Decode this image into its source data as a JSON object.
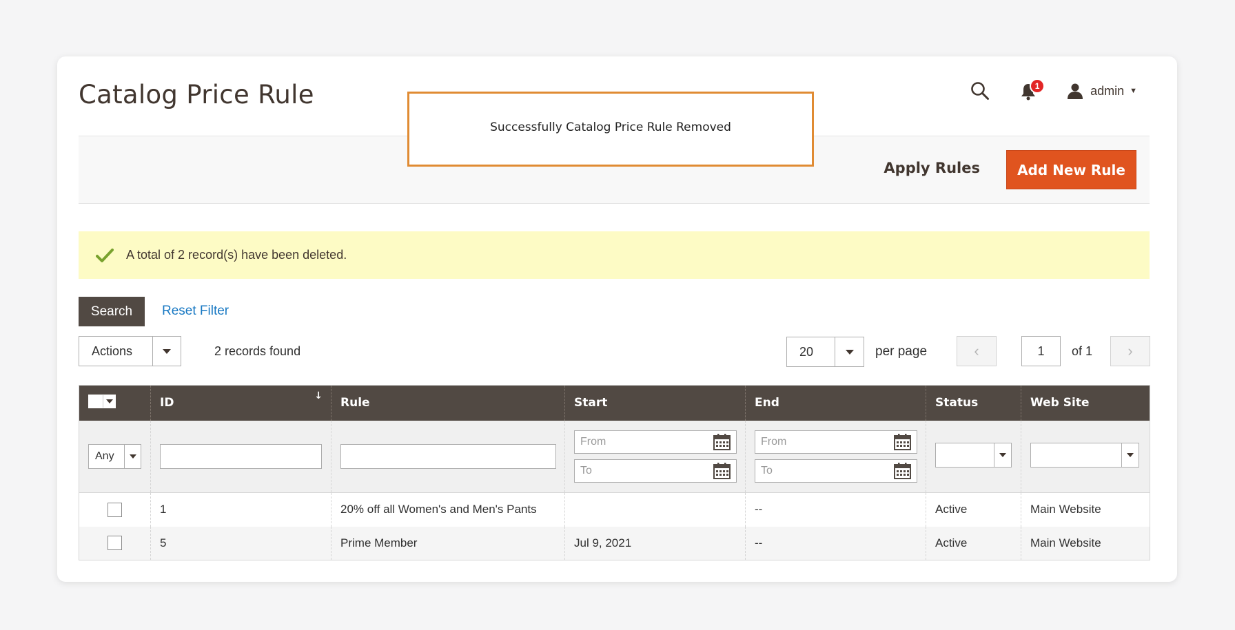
{
  "header": {
    "title": "Catalog Price Rule",
    "notification_count": "1",
    "user_name": "admin"
  },
  "callout": {
    "text": "Successfully Catalog Price Rule Removed"
  },
  "action_bar": {
    "apply_label": "Apply Rules",
    "add_label": "Add New Rule"
  },
  "message": {
    "text": "A total of 2 record(s) have been deleted."
  },
  "toolbar": {
    "search_label": "Search",
    "reset_label": "Reset Filter",
    "actions_label": "Actions",
    "records_found": "2 records found",
    "per_page_value": "20",
    "per_page_label": "per page",
    "prev_symbol": "‹",
    "next_symbol": "›",
    "current_page": "1",
    "of_pages": "of 1"
  },
  "grid": {
    "columns": {
      "id": "ID",
      "rule": "Rule",
      "start": "Start",
      "end": "End",
      "status": "Status",
      "website": "Web Site"
    },
    "sort_indicator": "↓",
    "filters": {
      "any_label": "Any",
      "from_placeholder": "From",
      "to_placeholder": "To"
    },
    "rows": [
      {
        "id": "1",
        "rule": "20% off all Women's and Men's Pants",
        "start": "",
        "end": "--",
        "status": "Active",
        "website": "Main Website"
      },
      {
        "id": "5",
        "rule": "Prime Member",
        "start": "Jul 9, 2021",
        "end": "--",
        "status": "Active",
        "website": "Main Website"
      }
    ]
  },
  "colors": {
    "accent": "#e0541f",
    "header_bg": "#514943",
    "message_bg": "#fdfbc5",
    "callout_border": "#e08b33",
    "link": "#1979c3"
  },
  "icons": {
    "search": "search-icon",
    "bell": "bell-icon",
    "user": "user-icon",
    "check": "check-icon",
    "calendar": "calendar-icon"
  }
}
